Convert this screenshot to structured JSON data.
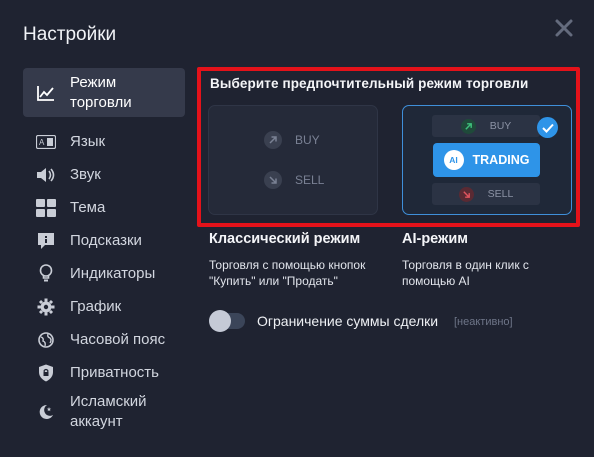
{
  "dialog": {
    "title": "Настройки"
  },
  "sidebar": {
    "items": [
      {
        "label": "Режим торговли",
        "icon": "chart-line-icon",
        "active": true
      },
      {
        "label": "Язык",
        "icon": "language-icon"
      },
      {
        "label": "Звук",
        "icon": "speaker-icon"
      },
      {
        "label": "Тема",
        "icon": "theme-grid-icon"
      },
      {
        "label": "Подсказки",
        "icon": "hint-icon"
      },
      {
        "label": "Индикаторы",
        "icon": "lightbulb-icon"
      },
      {
        "label": "График",
        "icon": "gear-icon"
      },
      {
        "label": "Часовой пояс",
        "icon": "globe-icon"
      },
      {
        "label": "Приватность",
        "icon": "shield-icon"
      },
      {
        "label": "Исламский аккаунт",
        "icon": "crescent-icon"
      }
    ]
  },
  "main": {
    "heading": "Выберите предпочтительный режим торговли",
    "modes": [
      {
        "title": "Классический режим",
        "description": "Торговля с помощью кнопок \"Купить\" или \"Продать\"",
        "buy_label": "BUY",
        "sell_label": "SELL",
        "selected": false
      },
      {
        "title": "AI-режим",
        "description": "Торговля в один клик с помощью AI",
        "buy_label": "BUY",
        "ai_badge": "AI",
        "button_label": "TRADING",
        "sell_label": "SELL",
        "selected": true
      }
    ],
    "limit_toggle": {
      "label": "Ограничение суммы сделки",
      "state": "[неактивно]",
      "on": false
    }
  },
  "colors": {
    "background": "#1f2331",
    "accent": "#2e94e8",
    "highlight_frame": "#e4121a",
    "buy_green": "#2aa66a",
    "sell_red": "#c8434b"
  }
}
